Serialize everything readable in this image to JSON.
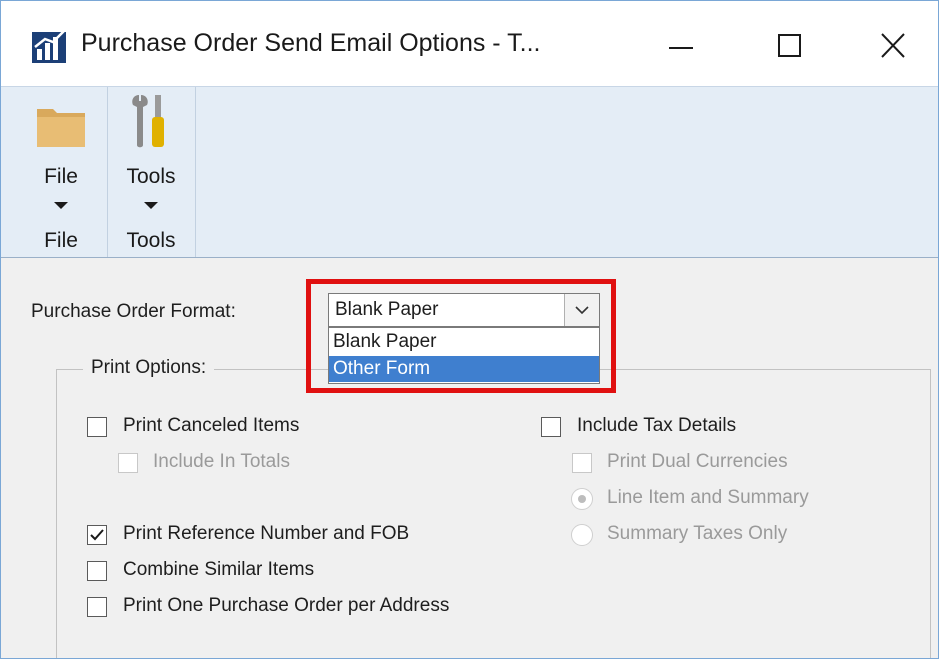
{
  "window": {
    "title": "Purchase Order Send Email Options  -  T...",
    "controls": {
      "minimize": "minimize",
      "maximize": "maximize",
      "close": "close"
    }
  },
  "ribbon": {
    "groups": [
      {
        "button_label": "File",
        "group_label": "File",
        "icon": "folder-icon"
      },
      {
        "button_label": "Tools",
        "group_label": "Tools",
        "icon": "tools-icon"
      }
    ]
  },
  "format": {
    "label": "Purchase Order Format:",
    "selected": "Blank Paper",
    "options": [
      "Blank Paper",
      "Other Form"
    ],
    "highlighted_option": "Other Form",
    "highlight_color": "#e01010"
  },
  "print_options": {
    "title": "Print Options:",
    "left": [
      {
        "label": "Print Canceled Items",
        "checked": false,
        "enabled": true
      },
      {
        "label": "Include In Totals",
        "checked": false,
        "enabled": false
      },
      {
        "label": "Print Reference Number and FOB",
        "checked": true,
        "enabled": true
      },
      {
        "label": "Combine Similar Items",
        "checked": false,
        "enabled": true
      },
      {
        "label": "Print One Purchase Order per Address",
        "checked": false,
        "enabled": true
      }
    ],
    "right": {
      "include_tax": {
        "label": "Include Tax Details",
        "checked": false,
        "enabled": true
      },
      "dual_currencies": {
        "label": "Print Dual Currencies",
        "checked": false,
        "enabled": false
      },
      "radios": [
        {
          "label": "Line Item and Summary",
          "selected": true,
          "enabled": false
        },
        {
          "label": "Summary Taxes Only",
          "selected": false,
          "enabled": false
        }
      ]
    }
  },
  "colors": {
    "window_border": "#7aa7d6",
    "ribbon_bg": "#e4edf6",
    "selection": "#3f7fcf"
  }
}
